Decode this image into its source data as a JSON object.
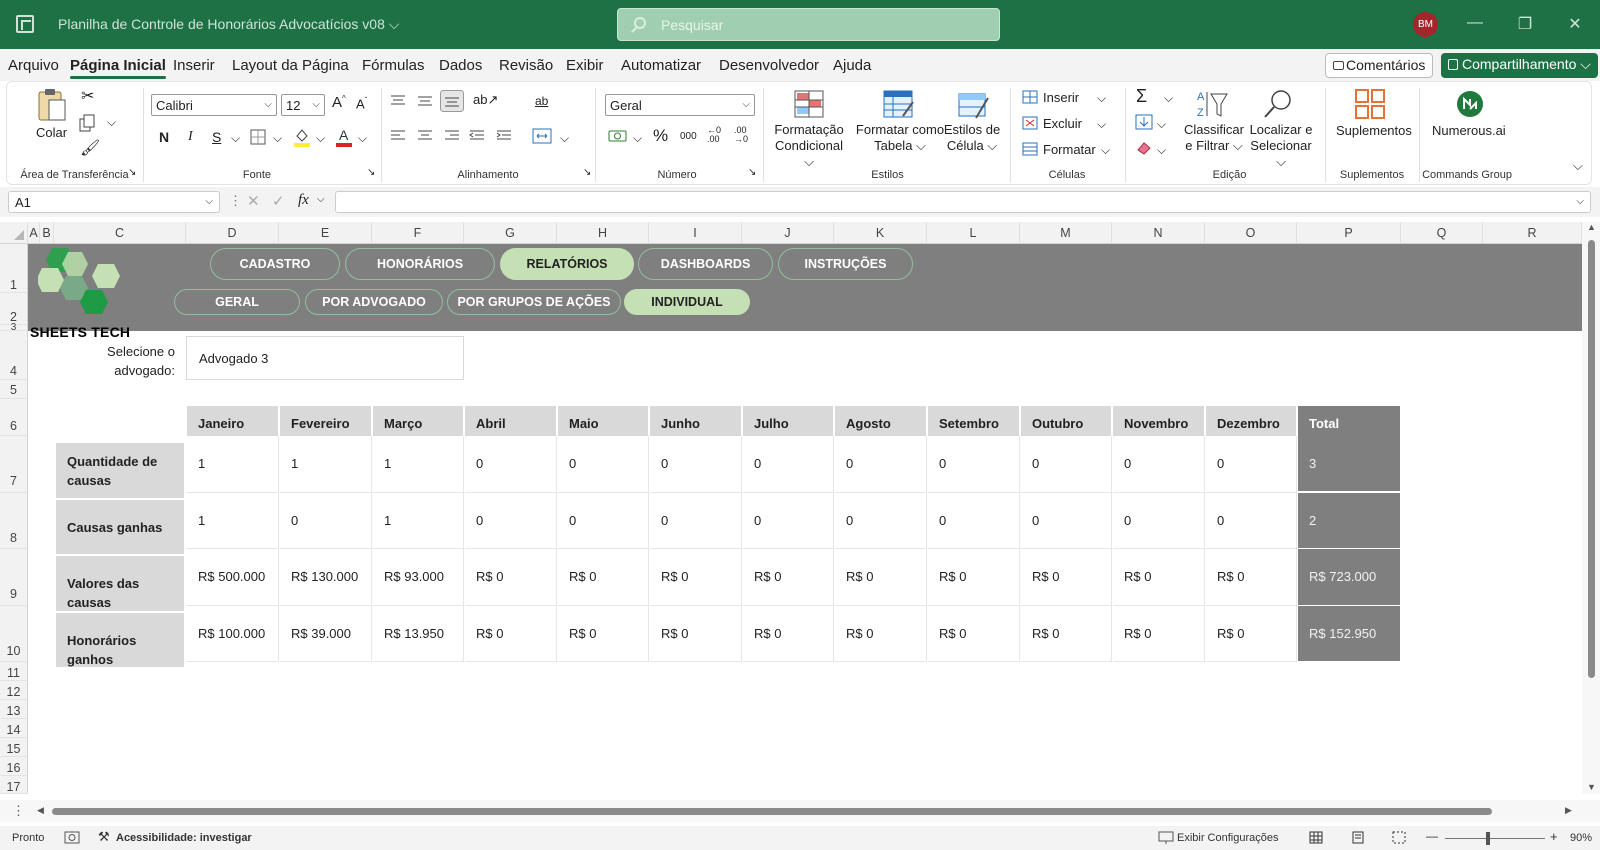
{
  "titlebar": {
    "document_title": "Planilha de Controle de Honorários Advocatícios v08 ⌵",
    "search_placeholder": "Pesquisar",
    "avatar_initials": "BM"
  },
  "menu": {
    "items": [
      "Arquivo",
      "Página Inicial",
      "Inserir",
      "Layout da Página",
      "Fórmulas",
      "Dados",
      "Revisão",
      "Exibir",
      "Automatizar",
      "Desenvolvedor",
      "Ajuda"
    ],
    "active": "Página Inicial",
    "comments_label": "Comentários",
    "share_label": "Compartilhamento ⌵"
  },
  "ribbon": {
    "clipboard": {
      "paste_label": "Colar",
      "group_label": "Área de Transferência"
    },
    "font": {
      "name": "Calibri",
      "size": "12",
      "group_label": "Fonte"
    },
    "alignment": {
      "group_label": "Alinhamento"
    },
    "number": {
      "format": "Geral",
      "group_label": "Número"
    },
    "styles": {
      "conditional": "Formatação Condicional ⌵",
      "table": "Formatar como Tabela ⌵",
      "cell_styles": "Estilos de Célula ⌵",
      "group_label": "Estilos"
    },
    "cells": {
      "insert": "Inserir",
      "delete": "Excluir",
      "format": "Formatar",
      "group_label": "Células"
    },
    "editing": {
      "sort": "Classificar e Filtrar ⌵",
      "find": "Localizar e Selecionar ⌵",
      "group_label": "Edição"
    },
    "addins": {
      "label": "Suplementos",
      "group_label": "Suplementos"
    },
    "numerous": {
      "label": "Numerous.ai",
      "group_label": "Commands Group"
    }
  },
  "formula_bar": {
    "name_box": "A1",
    "fx": "fx",
    "value": ""
  },
  "columns": [
    "A",
    "B",
    "C",
    "D",
    "E",
    "F",
    "G",
    "H",
    "I",
    "J",
    "K",
    "L",
    "M",
    "N",
    "O",
    "P",
    "Q",
    "R"
  ],
  "rows": [
    "1",
    "2",
    "3",
    "4",
    "5",
    "6",
    "7",
    "8",
    "9",
    "10",
    "11",
    "12",
    "13",
    "14",
    "15",
    "16",
    "17"
  ],
  "nav": {
    "top": [
      "CADASTRO",
      "HONORÁRIOS",
      "RELATÓRIOS",
      "DASHBOARDS",
      "INSTRUÇÕES"
    ],
    "top_active": "RELATÓRIOS",
    "sub": [
      "GERAL",
      "POR ADVOGADO",
      "POR GRUPOS DE AÇÕES",
      "INDIVIDUAL"
    ],
    "sub_active": "INDIVIDUAL"
  },
  "logo": {
    "text": "SHEETS TECH",
    "colors": [
      "#2e9e4f",
      "#c5e0b4",
      "#1f7a3c"
    ]
  },
  "selector": {
    "label": "Selecione o advogado:",
    "value": "Advogado 3"
  },
  "report": {
    "months": [
      "Janeiro",
      "Fevereiro",
      "Março",
      "Abril",
      "Maio",
      "Junho",
      "Julho",
      "Agosto",
      "Setembro",
      "Outubro",
      "Novembro",
      "Dezembro"
    ],
    "total_label": "Total",
    "rows": [
      {
        "label": "Quantidade de causas",
        "values": [
          "1",
          "1",
          "1",
          "0",
          "0",
          "0",
          "0",
          "0",
          "0",
          "0",
          "0",
          "0"
        ],
        "total": "3"
      },
      {
        "label": "Causas ganhas",
        "values": [
          "1",
          "0",
          "1",
          "0",
          "0",
          "0",
          "0",
          "0",
          "0",
          "0",
          "0",
          "0"
        ],
        "total": "2"
      },
      {
        "label": "Valores das causas",
        "values": [
          "R$ 500.000",
          "R$ 130.000",
          "R$ 93.000",
          "R$ 0",
          "R$ 0",
          "R$ 0",
          "R$ 0",
          "R$ 0",
          "R$ 0",
          "R$ 0",
          "R$ 0",
          "R$ 0"
        ],
        "total": "R$ 723.000"
      },
      {
        "label": "Honorários ganhos",
        "values": [
          "R$ 100.000",
          "R$ 39.000",
          "R$ 13.950",
          "R$ 0",
          "R$ 0",
          "R$ 0",
          "R$ 0",
          "R$ 0",
          "R$ 0",
          "R$ 0",
          "R$ 0",
          "R$ 0"
        ],
        "total": "R$ 152.950"
      }
    ]
  },
  "status": {
    "ready": "Pronto",
    "accessibility": "Acessibilidade: investigar",
    "display_settings": "Exibir Configurações",
    "zoom": "90%"
  },
  "colors": {
    "excel_green": "#1e7145",
    "banner_gray": "#7f7f7f",
    "active_pill": "#c5e0b4",
    "header_gray": "#d9d9d9"
  }
}
